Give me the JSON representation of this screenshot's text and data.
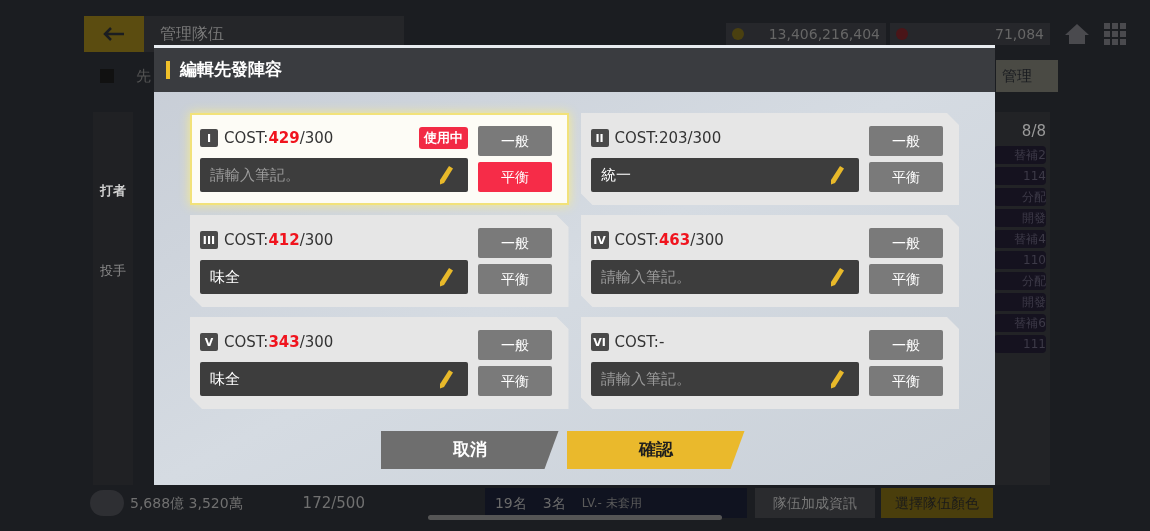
{
  "header": {
    "title": "管理隊伍",
    "gold": "13,406,216,404",
    "gems": "71,084"
  },
  "subbar": {
    "label": "先",
    "manage_button": "管理"
  },
  "side_tabs": [
    {
      "label": "打者",
      "selected": true
    },
    {
      "label": "投手",
      "selected": false
    }
  ],
  "roster": {
    "count": "8/8",
    "items": [
      "替補2",
      "114",
      "分配",
      "開發",
      "替補4",
      "110",
      "分配",
      "開發",
      "替補6",
      "111"
    ]
  },
  "footer": {
    "money": "5,688億 3,520萬",
    "capacity": "172/500",
    "t_count": "19名",
    "s_count": "3名",
    "st_level": "LV.- 未套用",
    "bonus_button": "隊伍加成資訊",
    "color_button": "選擇隊伍顏色"
  },
  "dialog": {
    "title": "編輯先發陣容",
    "lineups": [
      {
        "numeral": "I",
        "cost_label": "COST:",
        "cost_value": "429",
        "cost_limit": "/300",
        "over_limit": true,
        "active": true,
        "badge": "使用中",
        "note": {
          "placeholder": "請輸入筆記。"
        },
        "modes": [
          {
            "label": "一般",
            "selected": false
          },
          {
            "label": "平衡",
            "selected": true
          }
        ]
      },
      {
        "numeral": "II",
        "cost_label": "COST:",
        "cost_value": "203",
        "cost_limit": "/300",
        "over_limit": false,
        "active": false,
        "note": {
          "value": "統一"
        },
        "modes": [
          {
            "label": "一般",
            "selected": false
          },
          {
            "label": "平衡",
            "selected": false
          }
        ]
      },
      {
        "numeral": "III",
        "cost_label": "COST:",
        "cost_value": "412",
        "cost_limit": "/300",
        "over_limit": true,
        "active": false,
        "note": {
          "value": "味全"
        },
        "modes": [
          {
            "label": "一般",
            "selected": false
          },
          {
            "label": "平衡",
            "selected": false
          }
        ]
      },
      {
        "numeral": "IV",
        "cost_label": "COST:",
        "cost_value": "463",
        "cost_limit": "/300",
        "over_limit": true,
        "active": false,
        "note": {
          "placeholder": "請輸入筆記。"
        },
        "modes": [
          {
            "label": "一般",
            "selected": false
          },
          {
            "label": "平衡",
            "selected": false
          }
        ]
      },
      {
        "numeral": "V",
        "cost_label": "COST:",
        "cost_value": "343",
        "cost_limit": "/300",
        "over_limit": true,
        "active": false,
        "note": {
          "value": "味全"
        },
        "modes": [
          {
            "label": "一般",
            "selected": false
          },
          {
            "label": "平衡",
            "selected": false
          }
        ]
      },
      {
        "numeral": "VI",
        "cost_label": "COST:",
        "cost_value": "-",
        "over_limit": false,
        "active": false,
        "note": {
          "placeholder": "請輸入筆記。"
        },
        "modes": [
          {
            "label": "一般",
            "selected": false
          },
          {
            "label": "平衡",
            "selected": false
          }
        ]
      }
    ],
    "cancel": "取消",
    "confirm": "確認"
  }
}
